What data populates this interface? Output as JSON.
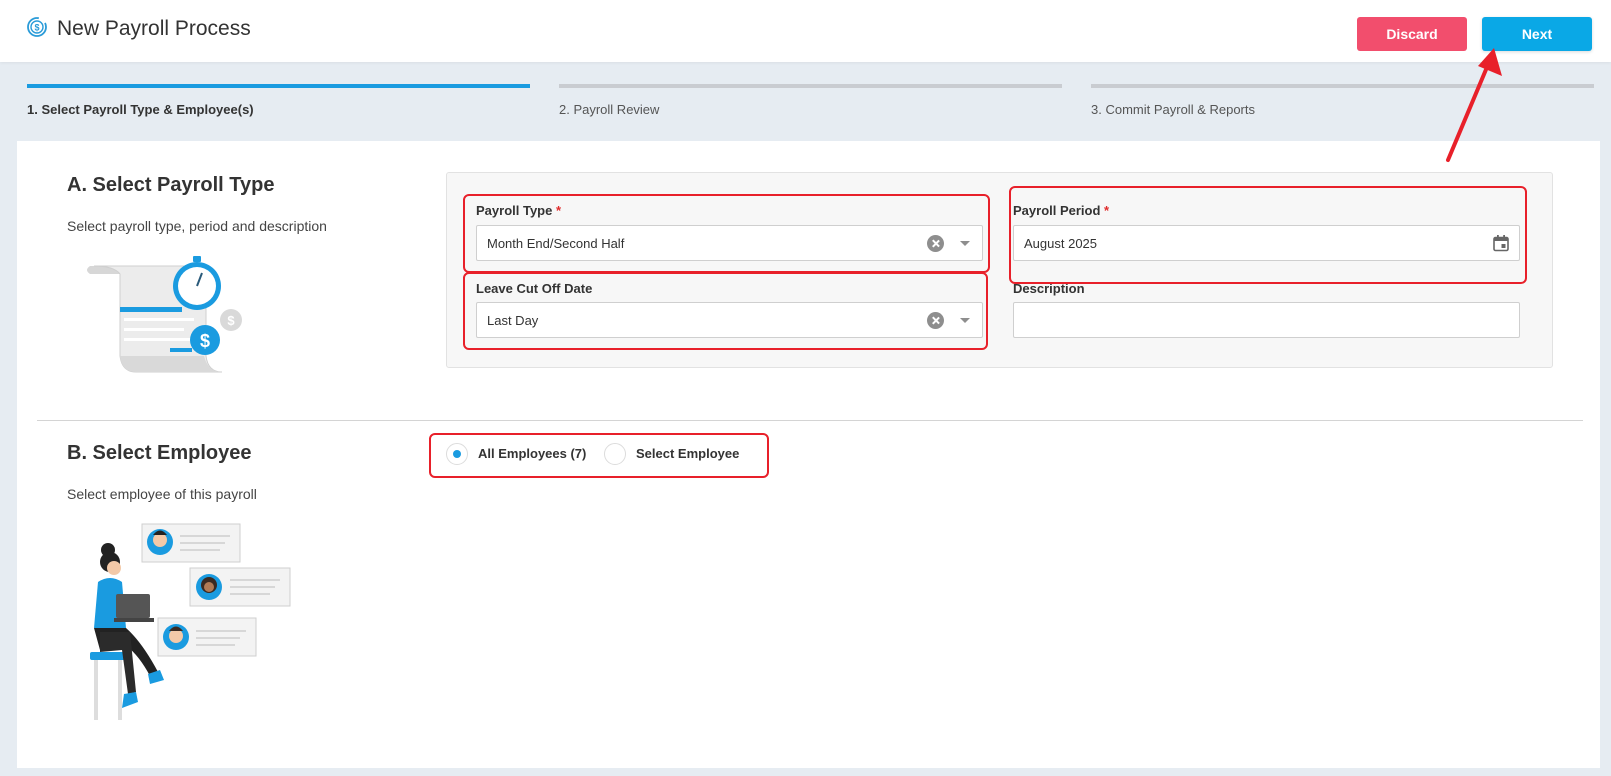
{
  "header": {
    "title": "New Payroll Process",
    "discard_label": "Discard",
    "next_label": "Next"
  },
  "steps": [
    {
      "label": "1. Select Payroll Type & Employee(s)",
      "active": true
    },
    {
      "label": "2. Payroll Review",
      "active": false
    },
    {
      "label": "3. Commit Payroll & Reports",
      "active": false
    }
  ],
  "section_a": {
    "title": "A. Select Payroll Type",
    "description": "Select payroll type, period and description",
    "payroll_type": {
      "label": "Payroll Type",
      "required_mark": "*",
      "value": "Month End/Second Half"
    },
    "payroll_period": {
      "label": "Payroll Period",
      "required_mark": "*",
      "value": "August 2025"
    },
    "leave_cut_off": {
      "label": "Leave Cut Off Date",
      "value": "Last Day"
    },
    "description_field": {
      "label": "Description",
      "value": ""
    }
  },
  "section_b": {
    "title": "B. Select Employee",
    "description": "Select employee of this payroll",
    "options": [
      {
        "label": "All Employees (7)",
        "checked": true
      },
      {
        "label": "Select Employee",
        "checked": false
      }
    ]
  },
  "colors": {
    "accent": "#1a9be0",
    "next_button": "#0aa8e6",
    "discard_button": "#f24e6d",
    "highlight": "#e8202a"
  },
  "icons": [
    "payroll-process-icon",
    "clear-icon",
    "chevron-down-icon",
    "calendar-icon"
  ]
}
